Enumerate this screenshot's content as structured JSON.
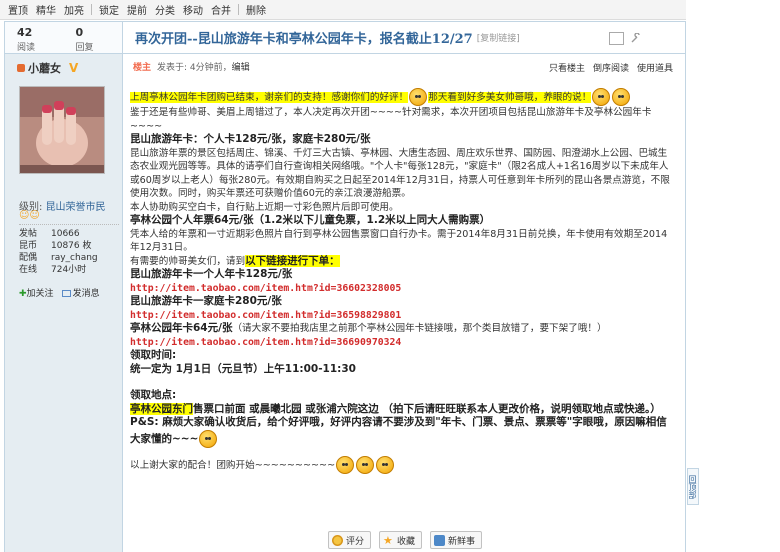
{
  "toolbar": {
    "items": [
      "置顶",
      "精华",
      "加亮",
      "锁定",
      "提前",
      "分类",
      "移动",
      "合并",
      "删除"
    ]
  },
  "stats": {
    "views": "42",
    "views_label": "阅读",
    "replies": "0",
    "replies_label": "回复"
  },
  "thread": {
    "title": "再次开团--昆山旅游年卡和亭林公园年卡，报名截止12/27",
    "copy_link": "[复制链接]"
  },
  "user": {
    "name": "小蘑女",
    "level_label": "级别:",
    "level_value": "昆山荣誉市民",
    "stats": [
      {
        "k": "发帖",
        "v": "10666"
      },
      {
        "k": "昆币",
        "v": "10876 枚"
      },
      {
        "k": "配偶",
        "v": "ray_chang"
      },
      {
        "k": "在线",
        "v": "724小时"
      }
    ],
    "add_friend": "加关注",
    "send_msg": "发消息"
  },
  "post": {
    "badge": "楼主",
    "posted": "发表于: 4分钟前，",
    "edit": "编辑",
    "tools": [
      "只看楼主",
      "倒序阅读",
      "使用道具"
    ],
    "lines": {
      "l1a": "上周亭林公园年卡团购已结束，谢亲们的支持！感谢你们的好评！",
      "l1b": "那天看到好多美女帅哥哦，养眼的说！",
      "l2": "鉴于还是有些帅哥、美眉上周错过了，本人决定再次开团~~~~针对需求，本次开团项目包括昆山旅游年卡及亭林公园年卡~~~~",
      "h1": "昆山旅游年卡：个人卡128元/张，家庭卡280元/张",
      "p1": "昆山旅游年票的景区包括周庄、锦溪、千灯三大古镇、亭林园、大唐生态园、周庄欢乐世界、国防园、阳澄湖水上公园、巴城生态农业观光园等等。具体的请亭们自行查询相关网络哦。\"个人卡\"每张128元，\"家庭卡\"（限2名成人+1名16周岁以下未成年人或60周岁以上老人）每张280元。有效期自购买之日起至2014年12月31日，持票人可任意到年卡所列的昆山各景点游览，不限使用次数。同时，购买年票还可获赠价值60元的亲江浪漫游船票。",
      "p2": "本人协助购买空白卡，自行贴上近期一寸彩色照片后即可使用。",
      "h2": "亭林公园个人年票64元/张（1.2米以下儿童免票，1.2米以上同大人需购票）",
      "p3": "凭本人给的年票和一寸近期彩色照片自行到亭林公园售票窗口自行办卡。需于2014年8月31日前兑换，年卡使用有效期至2014年12月31日。",
      "order_a": "有需要的帅哥美女们，请到",
      "order_b": "以下链接进行下单：",
      "k1": "昆山旅游年卡一个人年卡128元/张",
      "u1": "http://item.taobao.com/item.htm?id=36602328005",
      "k2": "昆山旅游年卡一家庭卡280元/张",
      "u2": "http://item.taobao.com/item.htm?id=36598829801",
      "k3a": "亭林公园年卡64元/张",
      "k3b": "（请大家不要拍我店里之前那个亭林公园年卡链接哦，那个类目放错了，要下架了哦！）",
      "u3": "http://item.taobao.com/item.htm?id=36690970324",
      "t_head": "领取时间:",
      "t_body": "统一定为 1月1日（元旦节）上午11:00-11:30",
      "loc_head": "领取地点:",
      "loc_a": "亭林公园东门",
      "loc_b": "售票口前面    或晨曦北园 或张浦六院这边 （拍下后请旺旺联系本人更改价格，说明领取地点或快递。）",
      "ps": "P&S: 麻烦大家确认收货后，给个好评哦，好评内容请不要涉及到\"年卡、门票、景点、票票等\"字眼哦，原因嘛相信大家懂的~~~",
      "thanks": "以上谢大家的配合！团购开始~~~~~~~~~~"
    }
  },
  "buttons": {
    "rate": "评分",
    "fav": "收藏",
    "new": "新鲜事"
  },
  "back_top": "回顶部"
}
